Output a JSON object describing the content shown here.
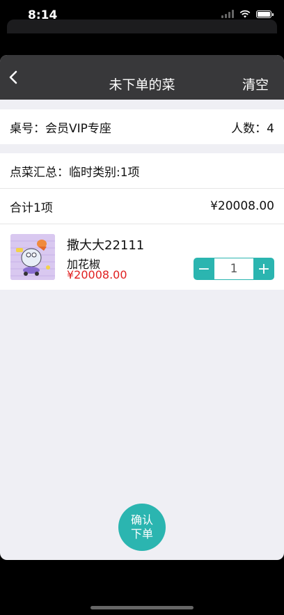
{
  "status_bar": {
    "time": "8:14"
  },
  "nav": {
    "title": "未下单的菜",
    "clear_label": "清空"
  },
  "table": {
    "label": "桌号：会员VIP专座",
    "people": "人数：4"
  },
  "summary": {
    "label": "点菜汇总：临时类别:1项"
  },
  "total": {
    "label": "合计1项",
    "amount": "¥20008.00"
  },
  "items": [
    {
      "name": "撒大大22111",
      "spec": "加花椒",
      "price": "¥20008.00",
      "quantity": "1"
    }
  ],
  "stepper": {
    "minus": "−",
    "plus": "+"
  },
  "confirm": {
    "line1": "确认",
    "line2": "下单"
  },
  "colors": {
    "accent": "#2bb5b0",
    "price": "#e02020",
    "navbar": "#38383a"
  }
}
